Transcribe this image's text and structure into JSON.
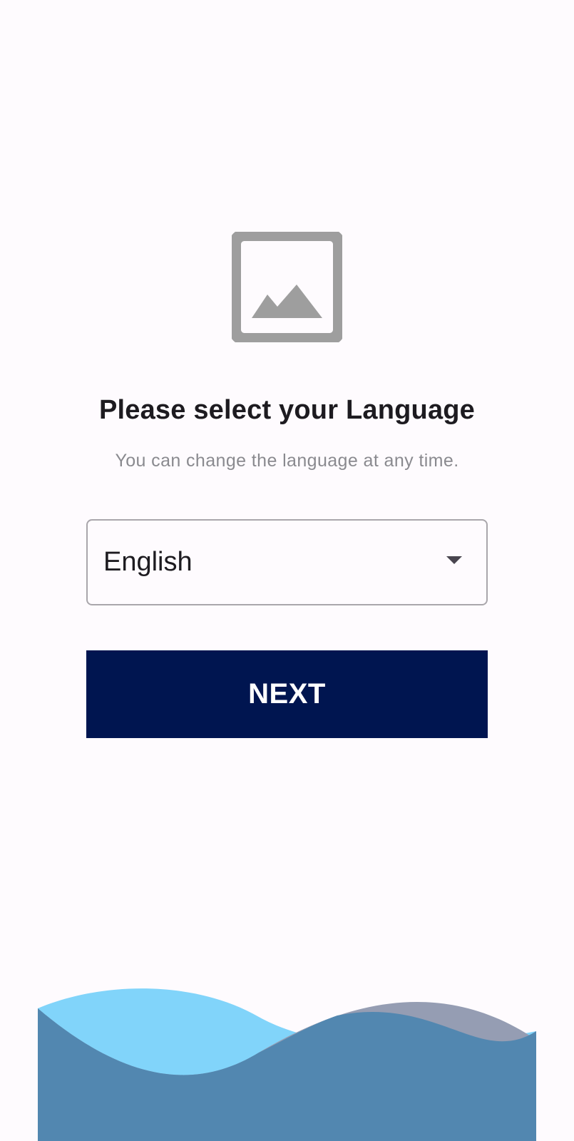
{
  "header": {
    "logo_icon": "image-placeholder-icon"
  },
  "main": {
    "title": "Please select your Language",
    "subtitle": "You can change the language at any time.",
    "language_select": {
      "value": "English",
      "icon": "arrow-drop-down-icon"
    },
    "next_label": "NEXT"
  },
  "footer": {
    "wave_icon": "wave-decoration",
    "colors": {
      "light_wave": "#81d4fa",
      "gray_wave": "#959db3",
      "dark_wave": "#5287b0"
    }
  },
  "colors": {
    "background": "#fefbfe",
    "primary": "#001550",
    "icon_gray": "#9e9e9e"
  }
}
